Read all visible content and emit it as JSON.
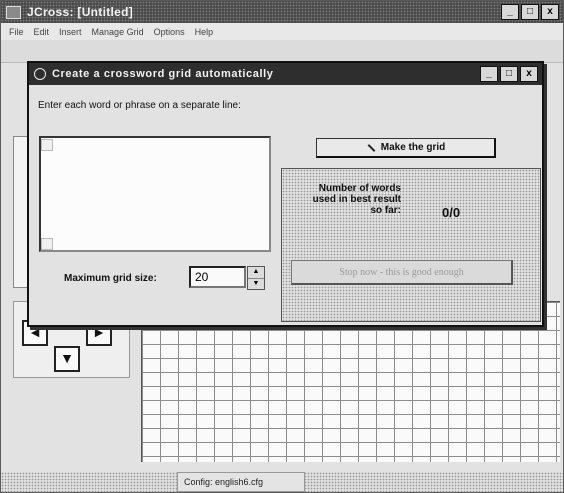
{
  "app": {
    "title": "JCross: [Untitled]",
    "window_buttons": [
      "_",
      "□",
      "x"
    ]
  },
  "menu": [
    "File",
    "Edit",
    "Insert",
    "Manage Grid",
    "Options",
    "Help"
  ],
  "statusbar": {
    "config": "Config: english6.cfg"
  },
  "dialog": {
    "title": "Create a crossword grid automatically",
    "window_buttons": [
      "_",
      "□",
      "x"
    ],
    "prompt": "Enter each word or phrase on a separate line:",
    "words_value": "",
    "max_grid_label": "Maximum grid size:",
    "max_grid_value": "20",
    "make_grid_label": "Make the grid",
    "result_label": "Number of words used in best result so far:",
    "result_value": "0/0",
    "accept_label": "Stop now - this is good enough"
  },
  "arrows": {
    "left": "◄",
    "right": "►",
    "down": "▼"
  }
}
